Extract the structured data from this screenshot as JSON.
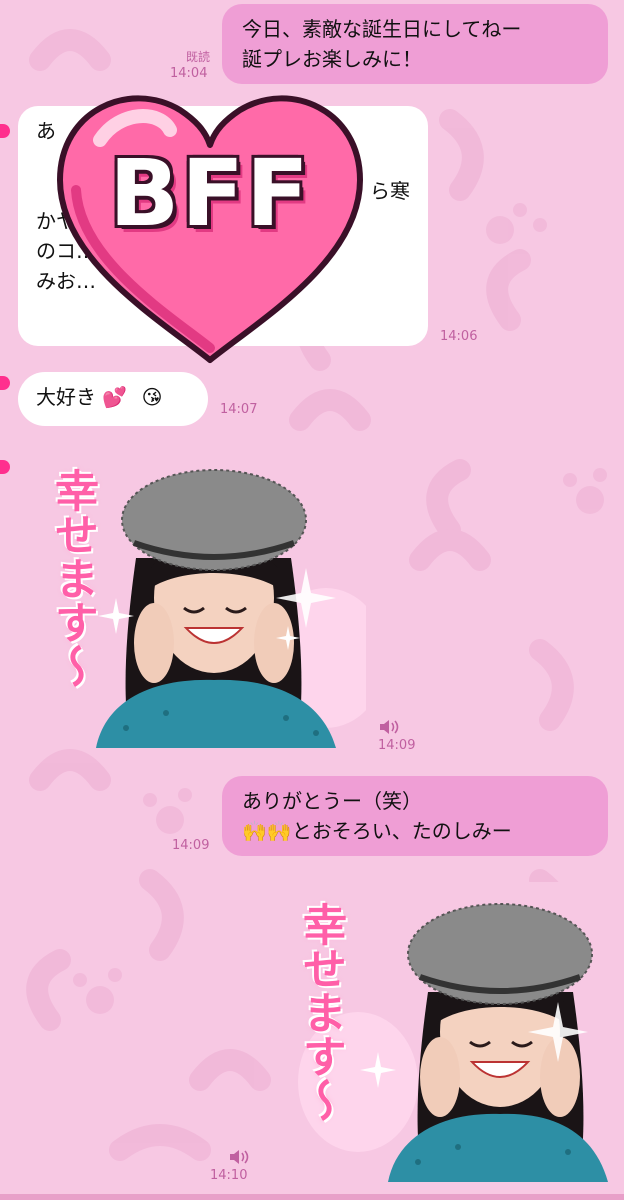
{
  "messages": {
    "m1": {
      "text_line1": "今日、素敵な誕生日にしてねー",
      "text_line2": "誕プレお楽しみに！",
      "read": "既読",
      "time": "14:04"
    },
    "m2": {
      "line1": "あ",
      "line2": "ら寒",
      "line3": "かヤマ",
      "line4": "のコ…",
      "line5": "みお…",
      "time": "14:06"
    },
    "m3": {
      "text": "大好き",
      "emoji1": "💕",
      "emoji2": "😘",
      "time": "14:07"
    },
    "m4": {
      "sticker_text": "幸せます〜",
      "time": "14:09"
    },
    "m5": {
      "line1": "ありがとうー（笑）",
      "line2": "とおそろい、たのしみー",
      "emoji": "🙌",
      "time": "14:09"
    },
    "m6": {
      "sticker_text": "幸せます〜",
      "time": "14:10"
    }
  },
  "overlay": {
    "badge_text": "BFF"
  },
  "icons": [
    "sound-icon",
    "heart-overlay"
  ],
  "colors": {
    "background": "#f7c8e3",
    "outgoing": "#ef9ed5",
    "incoming": "#ffffff",
    "accent": "#ff2f8e",
    "time": "#c060a0"
  }
}
